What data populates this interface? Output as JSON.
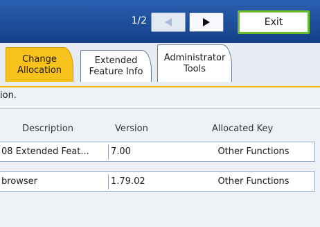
{
  "header": {
    "page_indicator": "1/2",
    "exit_label": "Exit",
    "prev_icon": "triangle-left-icon",
    "next_icon": "triangle-right-icon"
  },
  "tabs": [
    {
      "line1": "Change",
      "line2": "Allocation",
      "active": true
    },
    {
      "line1": "Extended",
      "line2": "Feature Info",
      "active": false
    },
    {
      "line1": "Administrator",
      "line2": "Tools",
      "active": false
    }
  ],
  "instruction_text": "ion.",
  "table": {
    "headers": [
      "Description",
      "Version",
      "Allocated Key"
    ],
    "rows": [
      {
        "description": "08 Extended Feat...",
        "version": "7.00",
        "key": "Other Functions"
      },
      {
        "description": "browser",
        "version": "1.79.02",
        "key": "Other Functions"
      }
    ]
  },
  "colors": {
    "header_blue": "#1e4e9b",
    "active_tab": "#f7c21c",
    "exit_border": "#6bbf2a"
  }
}
